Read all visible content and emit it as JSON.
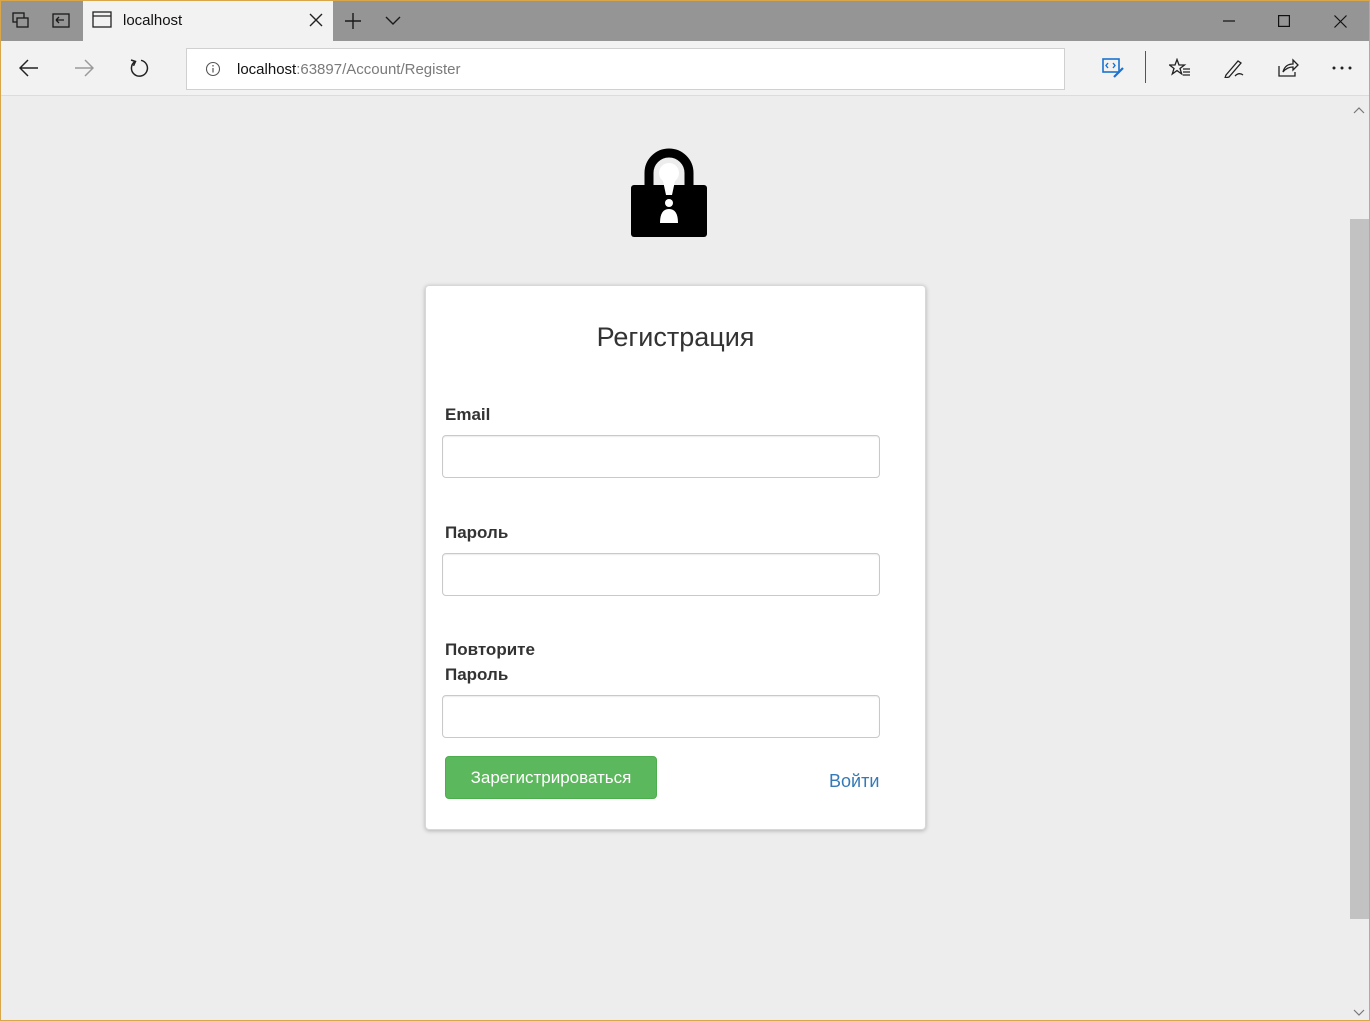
{
  "browser": {
    "tab": {
      "title": "localhost"
    },
    "address": {
      "host": "localhost",
      "path": ":63897/Account/Register"
    }
  },
  "page": {
    "title": "Регистрация",
    "fields": [
      {
        "label": "Email",
        "value": ""
      },
      {
        "label": "Пароль",
        "value": ""
      },
      {
        "label": "Повторите Пароль",
        "value": ""
      }
    ],
    "register_button": "Зарегистрироваться",
    "login_link": "Войти",
    "colors": {
      "success": "#5cb85c",
      "link": "#337ab7"
    }
  }
}
